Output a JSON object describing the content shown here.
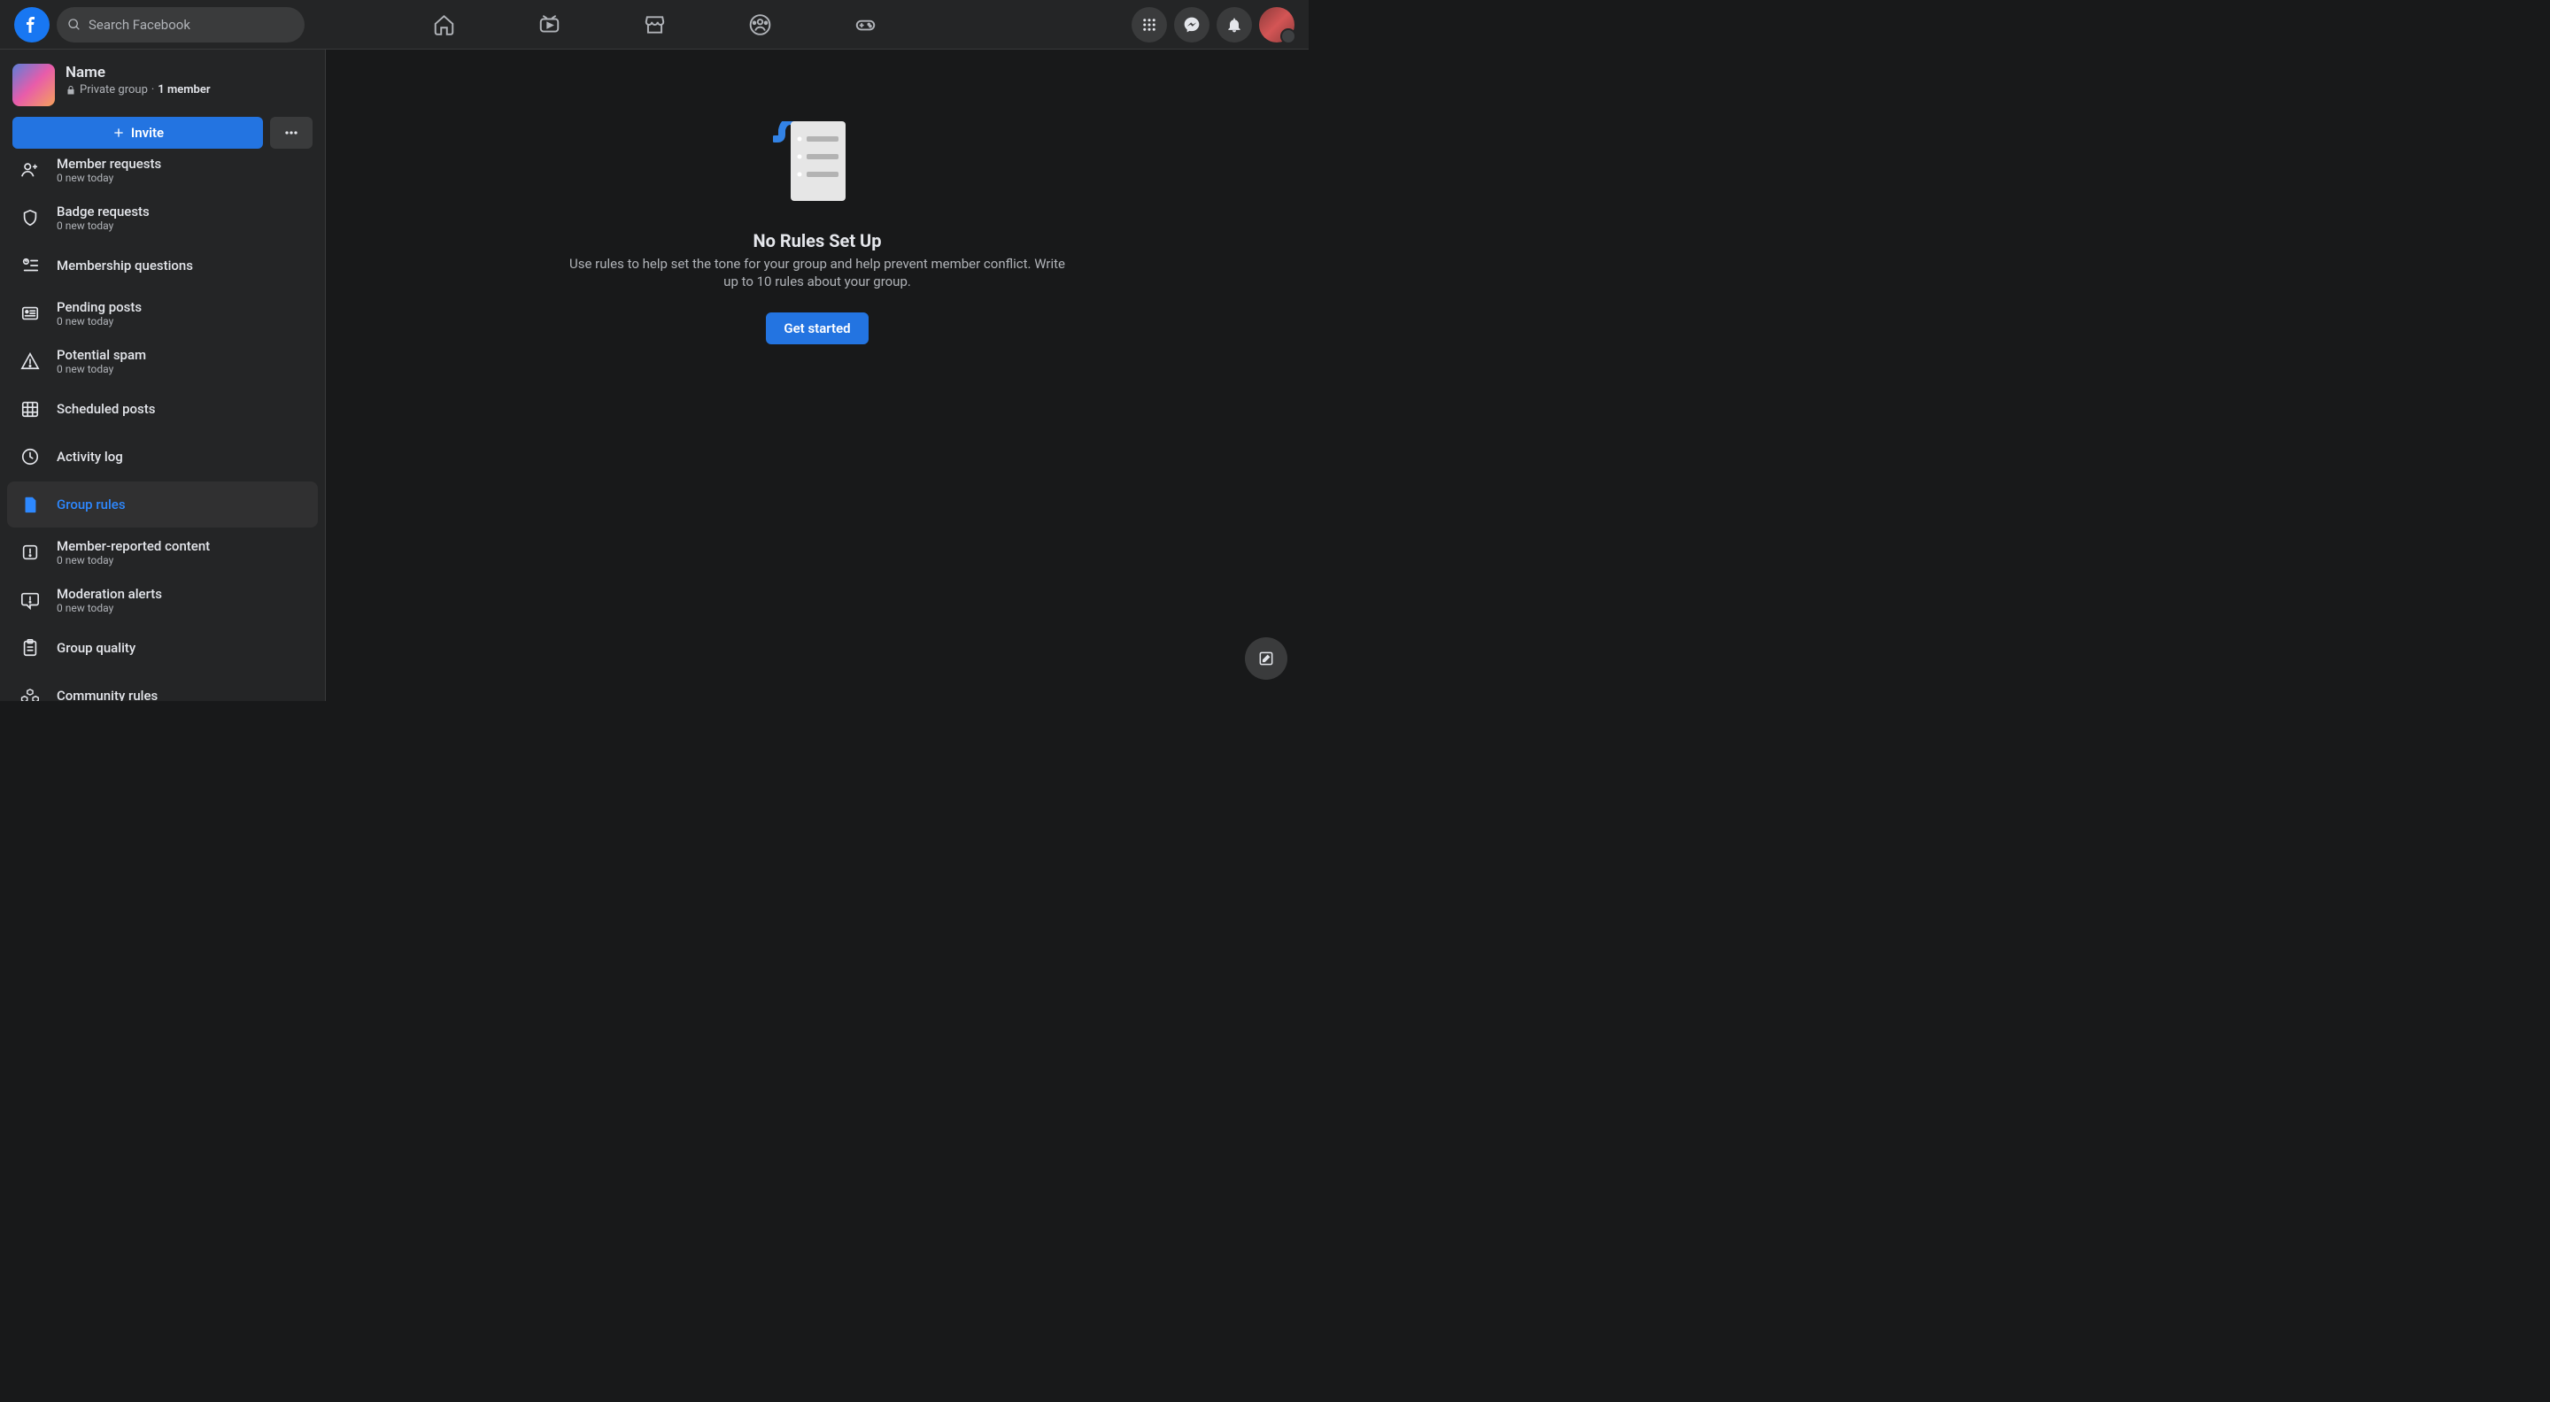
{
  "search": {
    "placeholder": "Search Facebook"
  },
  "group": {
    "name": "Name",
    "privacy": "Private group",
    "separator": "·",
    "members": "1 member",
    "invite_label": "Invite"
  },
  "sidebar": {
    "items": [
      {
        "label": "Member requests",
        "sub": "0 new today",
        "icon": "person-plus-icon"
      },
      {
        "label": "Badge requests",
        "sub": "0 new today",
        "icon": "shield-icon"
      },
      {
        "label": "Membership questions",
        "sub": "",
        "icon": "question-list-icon"
      },
      {
        "label": "Pending posts",
        "sub": "0 new today",
        "icon": "post-card-icon"
      },
      {
        "label": "Potential spam",
        "sub": "0 new today",
        "icon": "warning-triangle-icon"
      },
      {
        "label": "Scheduled posts",
        "sub": "",
        "icon": "calendar-grid-icon"
      },
      {
        "label": "Activity log",
        "sub": "",
        "icon": "clock-icon"
      },
      {
        "label": "Group rules",
        "sub": "",
        "icon": "document-icon",
        "active": true
      },
      {
        "label": "Member-reported content",
        "sub": "0 new today",
        "icon": "report-square-icon"
      },
      {
        "label": "Moderation alerts",
        "sub": "0 new today",
        "icon": "alert-bubble-icon"
      },
      {
        "label": "Group quality",
        "sub": "",
        "icon": "clipboard-icon"
      },
      {
        "label": "Community rules",
        "sub": "",
        "icon": "community-icon"
      }
    ]
  },
  "main": {
    "title": "No Rules Set Up",
    "description": "Use rules to help set the tone for your group and help prevent member conflict. Write up to 10 rules about your group.",
    "cta": "Get started"
  }
}
